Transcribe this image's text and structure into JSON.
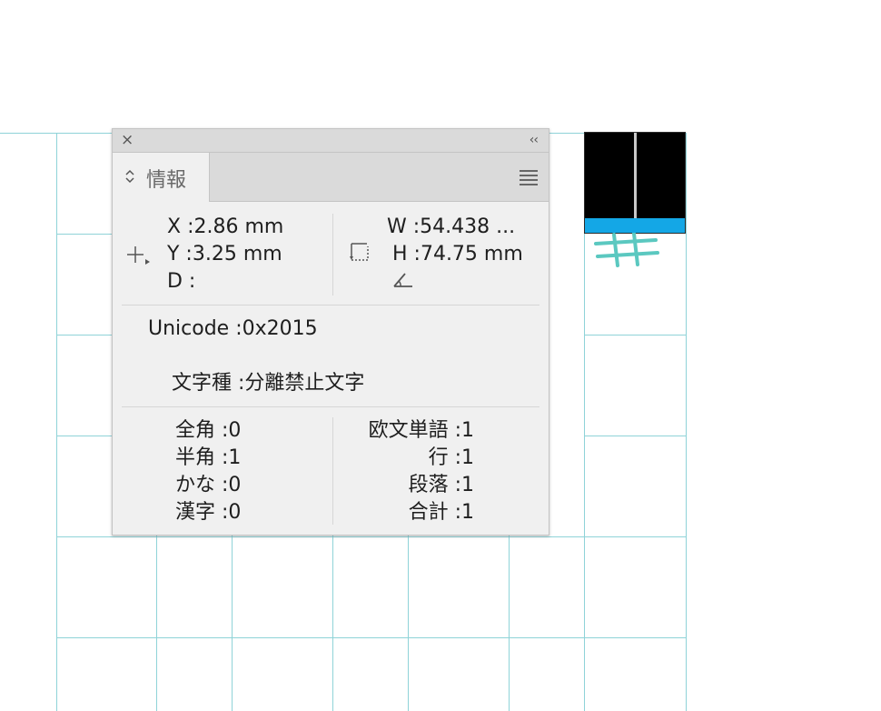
{
  "panel": {
    "tab_label": "情報",
    "close_glyph": "×",
    "collapse_glyph": "‹‹",
    "position": {
      "x": "X :2.86 mm",
      "y": "Y :3.25 mm",
      "d": "D :"
    },
    "size": {
      "w": "W :54.438 ...",
      "h": "H :74.75 mm"
    },
    "unicode": "Unicode :0x2015",
    "char_type": "文字種 :分離禁止文字",
    "counts_left": [
      "全角 :0",
      "半角 :1",
      "かな :0",
      "漢字 :0"
    ],
    "counts_right": [
      "欧文単語 :1",
      "行 :1",
      "段落 :1",
      "合計 :1"
    ]
  },
  "icons": [
    "crosshair-icon",
    "size-box-icon",
    "angle-icon",
    "close-icon",
    "collapse-icon",
    "panel-menu-icon",
    "tab-arrows-icon"
  ],
  "colors": {
    "grid": "#8fd3d8",
    "selection_bar": "#14a7e6",
    "frame_fill": "#000000",
    "glyph_mark": "#5bc8c0"
  }
}
